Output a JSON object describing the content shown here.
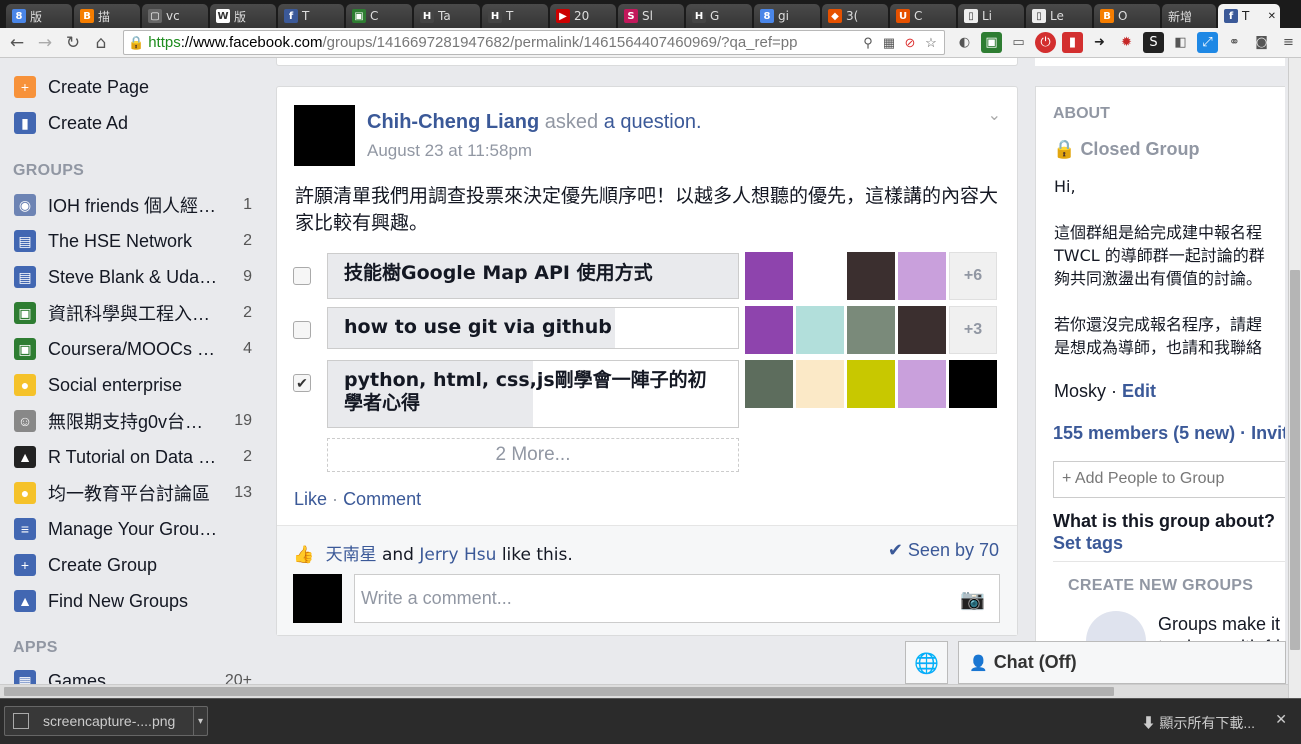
{
  "browser": {
    "tabs": [
      {
        "label": "版",
        "fav": "8",
        "color": "#4a86e8"
      },
      {
        "label": "描",
        "fav": "B",
        "color": "#f57d00"
      },
      {
        "label": "vc",
        "fav": "▢",
        "color": "#666666"
      },
      {
        "label": "版",
        "fav": "W",
        "color": "#ffffff"
      },
      {
        "label": "T",
        "fav": "f",
        "color": "#3b5998"
      },
      {
        "label": "C",
        "fav": "▣",
        "color": "#2e7d32"
      },
      {
        "label": "Ta",
        "fav": "H",
        "color": "#444444"
      },
      {
        "label": "T",
        "fav": "H",
        "color": "#444444"
      },
      {
        "label": "20",
        "fav": "▶",
        "color": "#cc0000"
      },
      {
        "label": "Sl",
        "fav": "S",
        "color": "#c2185b"
      },
      {
        "label": "G",
        "fav": "H",
        "color": "#444444"
      },
      {
        "label": "gi",
        "fav": "8",
        "color": "#4a86e8"
      },
      {
        "label": "3(",
        "fav": "◆",
        "color": "#e65100"
      },
      {
        "label": "C",
        "fav": "U",
        "color": "#e65100"
      },
      {
        "label": "Li",
        "fav": "▯",
        "color": "#eeeeee"
      },
      {
        "label": "Le",
        "fav": "▯",
        "color": "#eeeeee"
      },
      {
        "label": "O",
        "fav": "B",
        "color": "#f57d00"
      },
      {
        "label": "新增",
        "fav": "",
        "color": "transparent"
      }
    ],
    "active_tab": {
      "label": "T",
      "fav": "f",
      "color": "#3b5998"
    },
    "url_https": "https",
    "url_host": "://www.facebook.com",
    "url_path": "/groups/1416697281947682/permalink/1461564407460969/?qa_ref=pp"
  },
  "sidebar": {
    "top_items": [
      {
        "label": "Create Page",
        "icon": "plus-icon",
        "glyph": "+",
        "color": "#f7923a"
      },
      {
        "label": "Create Ad",
        "icon": "chart-icon",
        "glyph": "▮",
        "color": "#4267b2"
      }
    ],
    "groups_heading": "GROUPS",
    "groups": [
      {
        "label": "IOH friends 個人經…",
        "count": "1",
        "glyph": "◉",
        "color": "#6d84b4"
      },
      {
        "label": "The HSE Network",
        "count": "2",
        "glyph": "▤",
        "color": "#4267b2"
      },
      {
        "label": "Steve Blank & Udac…",
        "count": "9",
        "glyph": "▤",
        "color": "#4267b2"
      },
      {
        "label": "資訊科學與工程入…",
        "count": "2",
        "glyph": "▣",
        "color": "#2e7d32"
      },
      {
        "label": "Coursera/MOOCs …",
        "count": "4",
        "glyph": "▣",
        "color": "#2e7d32"
      },
      {
        "label": "Social enterprise",
        "count": "",
        "glyph": "●",
        "color": "#f5c22a"
      },
      {
        "label": "無限期支持g0v台灣…",
        "count": "19",
        "glyph": "☺",
        "color": "#888888"
      },
      {
        "label": "R Tutorial on Data …",
        "count": "2",
        "glyph": "▲",
        "color": "#222222"
      },
      {
        "label": "均一教育平台討論區",
        "count": "13",
        "glyph": "●",
        "color": "#f5c22a"
      },
      {
        "label": "Manage Your Groups",
        "count": "",
        "glyph": "≡",
        "color": "#4267b2"
      },
      {
        "label": "Create Group",
        "count": "",
        "glyph": "+",
        "color": "#4267b2"
      },
      {
        "label": "Find New Groups",
        "count": "",
        "glyph": "▲",
        "color": "#4267b2"
      }
    ],
    "apps_heading": "APPS",
    "apps": [
      {
        "label": "Games",
        "count": "20+"
      }
    ]
  },
  "post": {
    "author": "Chih-Cheng Liang",
    "asked": "asked",
    "question_link": "a question.",
    "time": "August 23 at 11:58pm",
    "text": "許願清單我們用調查投票來決定優先順序吧！以越多人想聽的優先，這樣講的內容大家比較有興趣。",
    "poll": [
      {
        "label": "技能樹Google Map API 使用方式",
        "checked": false,
        "fill": 1.0,
        "more": "+6",
        "voters": [
          "#8e44ad",
          "#ffffff",
          "#3b2f2f",
          "#c9a0dc"
        ]
      },
      {
        "label": "how to use git via github",
        "checked": false,
        "fill": 0.7,
        "more": "+3",
        "voters": [
          "#8e44ad",
          "#b2dfdb",
          "#7a8a7a",
          "#3b2f2f"
        ]
      },
      {
        "label": "python, html, css,js剛學會一陣子的初學者心得",
        "checked": true,
        "fill": 0.5,
        "more": "",
        "voters": [
          "#5d6d5d",
          "#fbe9c7",
          "#c8c800",
          "#c9a0dc",
          "#000000"
        ]
      }
    ],
    "more_options": "2 More...",
    "like_label": "Like",
    "separator": "·",
    "comment_label": "Comment",
    "likers": [
      "天南星",
      "Jerry Hsu"
    ],
    "and_text": "and",
    "like_this": "like this.",
    "seen_by": "Seen by 70",
    "comment_placeholder": "Write a comment..."
  },
  "right": {
    "about_heading": "ABOUT",
    "closed_group": "Closed Group",
    "desc_lines": [
      "Hi,",
      "",
      "這個群組是給完成建中報名程",
      "TWCL 的導師群一起討論的群",
      "夠共同激盪出有價值的討論。",
      "",
      "若你還沒完成報名程序，請趕",
      "是想成為導師，也請和我聯絡"
    ],
    "mosky": "Mosky",
    "edit": "Edit",
    "members": "155 members  (5 new) · Invit",
    "add_people": "Add People to Group",
    "what_about": "What is this group about?",
    "set_tags": "Set tags",
    "create_heading": "CREATE NEW GROUPS",
    "promo_lines": [
      "Groups make it",
      "to share with frie"
    ]
  },
  "chat": {
    "label": "Chat (Off)"
  },
  "downloads": {
    "file": "screencapture-....png",
    "show_all": "顯示所有下載..."
  }
}
